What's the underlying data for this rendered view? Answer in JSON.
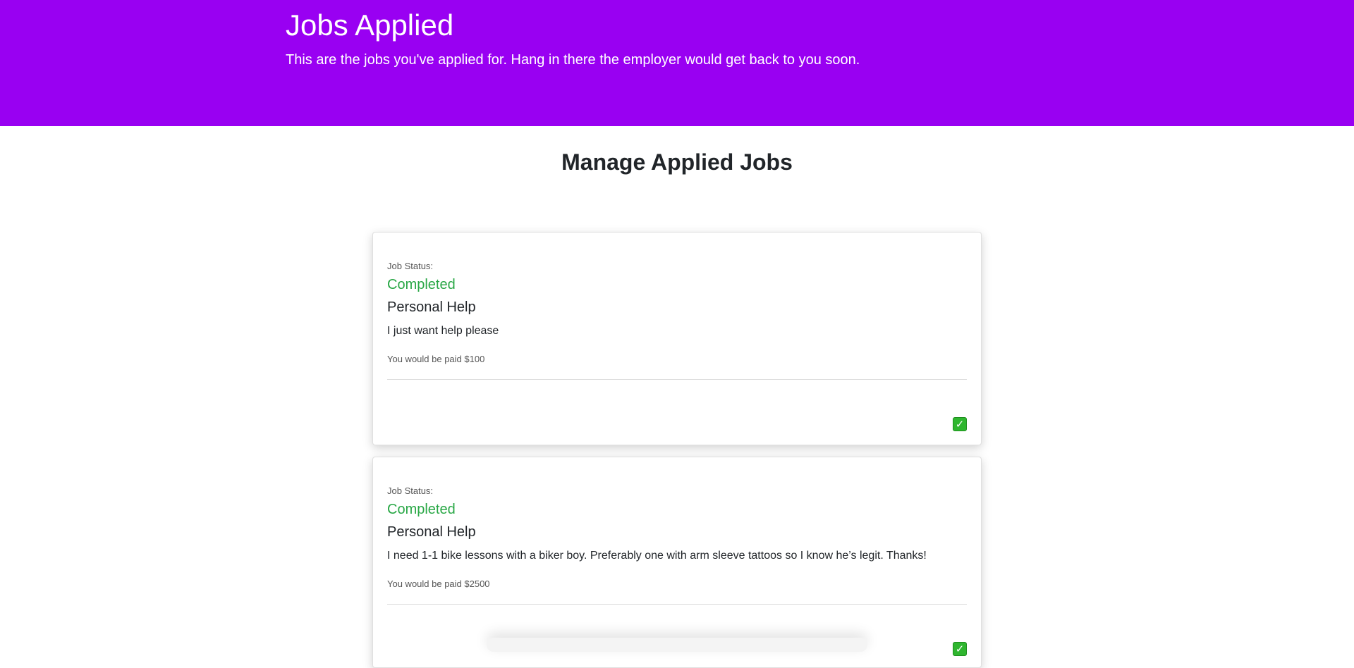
{
  "header": {
    "title": "Jobs Applied",
    "subtitle": "This are the jobs you've applied for. Hang in there the employer would get back to you soon."
  },
  "main": {
    "section_title": "Manage Applied Jobs",
    "jobs": [
      {
        "status_label": "Job Status:",
        "status": "Completed",
        "title": "Personal Help",
        "description": "I just want help please",
        "pay": "You would be paid $100",
        "action_icon": "check-mark-button-icon"
      },
      {
        "status_label": "Job Status:",
        "status": "Completed",
        "title": "Personal Help",
        "description": "I need 1-1 bike lessons with a biker boy. Preferably one with arm sleeve tattoos so I know he’s legit. Thanks!",
        "pay": "You would be paid $2500",
        "action_icon": "check-mark-button-icon"
      }
    ]
  },
  "colors": {
    "hero_bg": "#9900f2",
    "status_completed": "#28a745",
    "check_button": "#2fb62f"
  }
}
